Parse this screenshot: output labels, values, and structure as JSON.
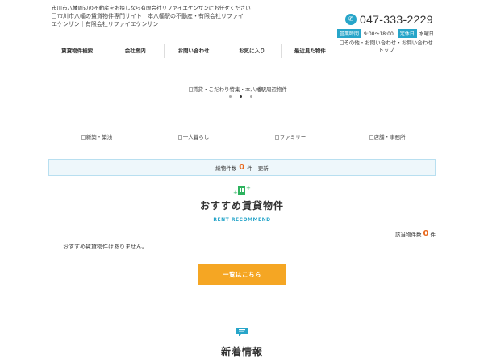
{
  "header": {
    "tagline": "市川市八幡周辺の不動産をお探しなら有限会社リファイエケンザンにお任せください！",
    "logo_alt": "市川市八幡の賃貸物件専門サイト　本八幡駅の不動産・有限会社リファイエケンザン｜有限会社リファイエケンザン",
    "phone": "047-333-2229",
    "hours_tag": "営業時間",
    "hours": "9:00～18:00",
    "holiday_tag": "定休日",
    "holiday": "水曜日",
    "contact_alt": "その他・お問い合わせ・お問い合わせトップ"
  },
  "nav": {
    "items": [
      {
        "label": "賃貸物件検索"
      },
      {
        "label": "会社案内"
      },
      {
        "label": "お問い合わせ"
      },
      {
        "label": "お気に入り"
      },
      {
        "label": "最近見た物件"
      }
    ]
  },
  "banner": {
    "alt": "賃貸・こだわり特集・本八幡駅周辺物件"
  },
  "categories": [
    {
      "label": "新築・築浅"
    },
    {
      "label": "一人暮らし"
    },
    {
      "label": "ファミリー"
    },
    {
      "label": "店舗・事務所"
    }
  ],
  "count_bar": {
    "prefix": "総物件数",
    "count": "0",
    "unit": "件",
    "suffix": "更新"
  },
  "recommend": {
    "title": "おすすめ賃貸物件",
    "subtitle": "RENT RECOMMEND",
    "hit_label": "該当物件数",
    "hit_count": "0",
    "hit_unit": "件",
    "empty_message": "おすすめ賃貸物件はありません。",
    "button_label": "一覧はこちら"
  },
  "news": {
    "title": "新着情報"
  },
  "colors": {
    "accent_blue": "#27a5c9",
    "accent_orange": "#f5a623",
    "count_orange": "#e8671b",
    "icon_green": "#2eb35f"
  }
}
